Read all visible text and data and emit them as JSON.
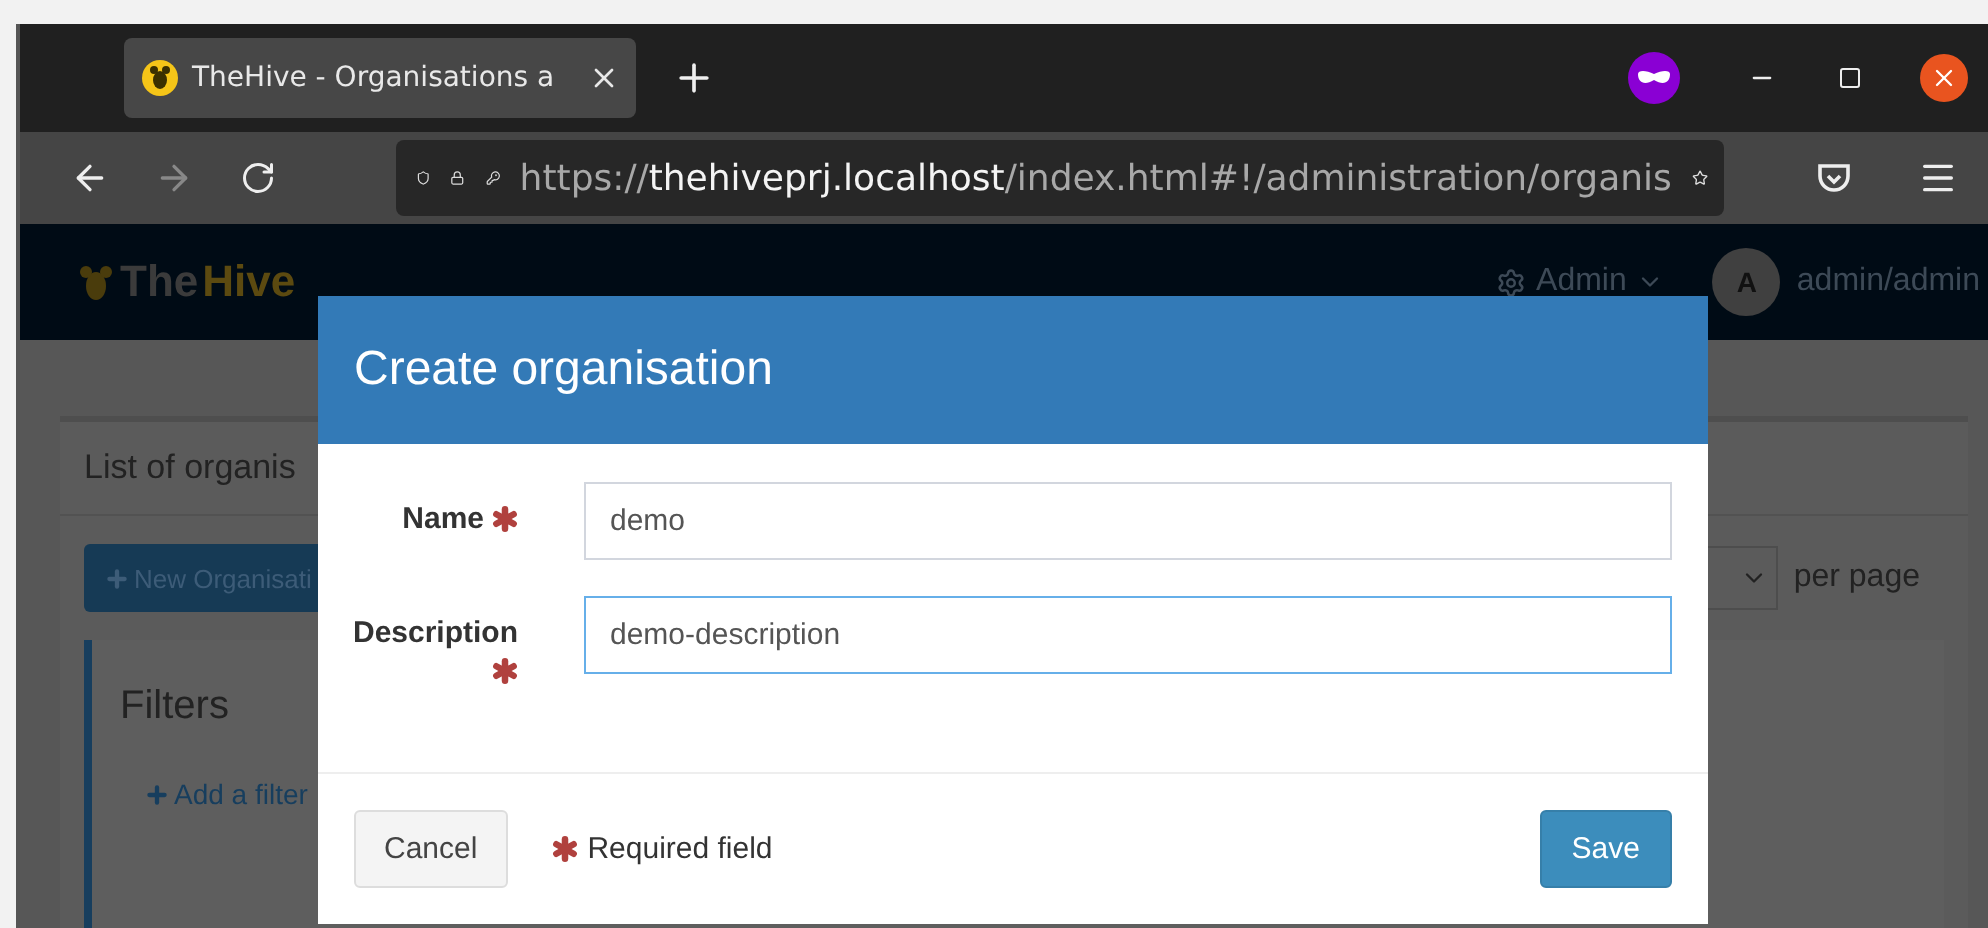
{
  "browser": {
    "tab_title": "TheHive - Organisations a",
    "url": {
      "scheme": "https://",
      "host": "thehiveprj.localhost",
      "path": "/index.html#!/administration/organis"
    }
  },
  "app_header": {
    "logo": {
      "first": "The",
      "second": "Hive"
    },
    "admin_menu": "Admin",
    "user": {
      "initial": "A",
      "name": "admin/admin"
    }
  },
  "page": {
    "title": "List of organis",
    "new_button": "New Organisati",
    "per_page": "per page",
    "filters": {
      "title": "Filters",
      "add": "Add a filter"
    }
  },
  "modal": {
    "title": "Create organisation",
    "fields": [
      {
        "label": "Name",
        "value": "demo",
        "required": true,
        "focused": false
      },
      {
        "label": "Description",
        "value": "demo-description",
        "required": true,
        "focused": true
      }
    ],
    "cancel": "Cancel",
    "required_note": "Required field",
    "save": "Save"
  }
}
